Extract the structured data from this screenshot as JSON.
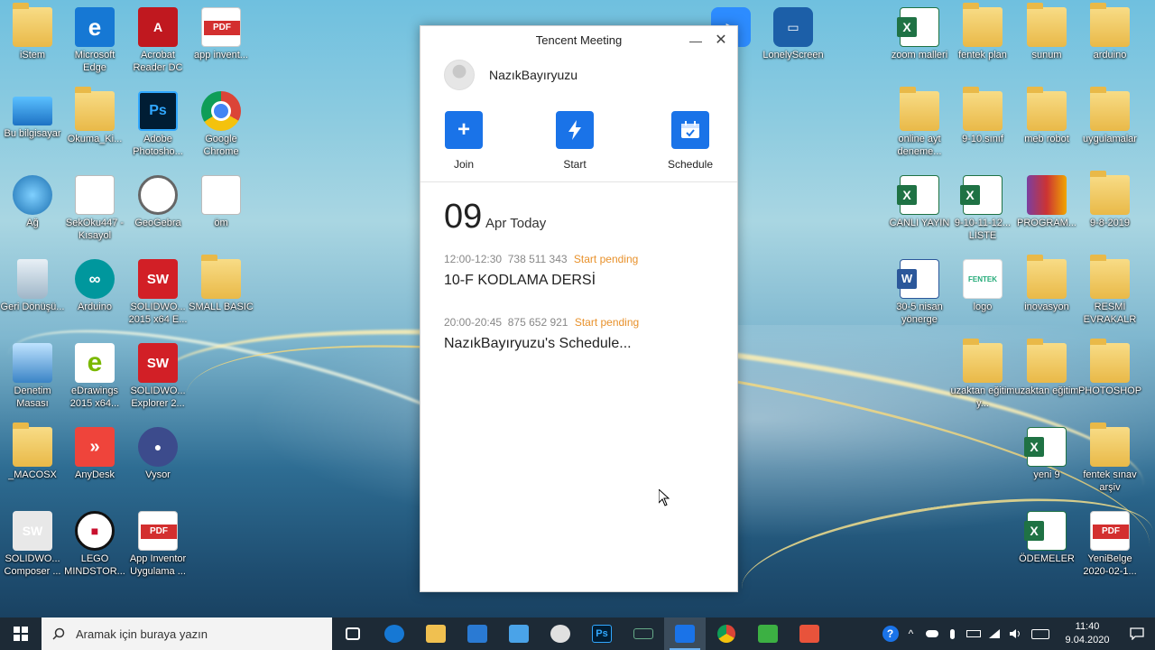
{
  "desktop_left": [
    {
      "label": "iStem",
      "kind": "folder"
    },
    {
      "label": "Microsoft Edge",
      "kind": "edge"
    },
    {
      "label": "Acrobat Reader DC",
      "kind": "acro"
    },
    {
      "label": "app invent...",
      "kind": "pdf"
    },
    {
      "label": "Bu bilgisayar",
      "kind": "pc"
    },
    {
      "label": "Okuma_Ki...",
      "kind": "folder"
    },
    {
      "label": "Adobe Photosho...",
      "kind": "ps"
    },
    {
      "label": "Google Chrome",
      "kind": "chrome"
    },
    {
      "label": "Ağ",
      "kind": "net"
    },
    {
      "label": "SekOku447 - Kısayol",
      "kind": "doc"
    },
    {
      "label": "GeoGebra",
      "kind": "geo"
    },
    {
      "label": "öm",
      "kind": "doc"
    },
    {
      "label": "Geri Dönüşü...",
      "kind": "bin"
    },
    {
      "label": "Arduino",
      "kind": "ard"
    },
    {
      "label": "SOLIDWO... 2015 x64 E...",
      "kind": "sw"
    },
    {
      "label": "SMALL BASIC",
      "kind": "folder"
    },
    {
      "label": "Denetim Masası",
      "kind": "ctrl"
    },
    {
      "label": "eDrawings 2015 x64...",
      "kind": "ed"
    },
    {
      "label": "SOLIDWO... Explorer 2...",
      "kind": "sw"
    },
    {
      "label": "_MACOSX",
      "kind": "folder"
    },
    {
      "label": "AnyDesk",
      "kind": "any"
    },
    {
      "label": "Vysor",
      "kind": "vys"
    },
    {
      "label": "SOLIDWO... Composer ...",
      "kind": "swc"
    },
    {
      "label": "LEGO MINDSTOR...",
      "kind": "lego"
    },
    {
      "label": "App Inventor Uygulama ...",
      "kind": "pdf"
    }
  ],
  "desktop_top": [
    {
      "label": "n",
      "kind": "zoom"
    },
    {
      "label": "LonelyScreen",
      "kind": "ls"
    }
  ],
  "desktop_right": [
    {
      "label": "zoom malleri",
      "kind": "xls"
    },
    {
      "label": "fentek plan",
      "kind": "folder"
    },
    {
      "label": "sunum",
      "kind": "folder"
    },
    {
      "label": "arduino",
      "kind": "folder"
    },
    {
      "label": "online ayt deneme...",
      "kind": "folder"
    },
    {
      "label": "9-10.sınıf",
      "kind": "folder"
    },
    {
      "label": "meb robot",
      "kind": "folder"
    },
    {
      "label": "uygulamalar",
      "kind": "folder"
    },
    {
      "label": "CANLI YAYIN",
      "kind": "xls"
    },
    {
      "label": "9-10-11-12... LİSTE",
      "kind": "xls"
    },
    {
      "label": "PROGRAM...",
      "kind": "rar"
    },
    {
      "label": "9-8-2019",
      "kind": "folder"
    },
    {
      "label": "30-5 nisan yönerge",
      "kind": "word"
    },
    {
      "label": "logo",
      "kind": "fentek"
    },
    {
      "label": "inovasyon",
      "kind": "folder"
    },
    {
      "label": "RESMİ EVRAKALR",
      "kind": "folder"
    },
    {
      "label": "uzaktan eğitim y...",
      "kind": "folder"
    },
    {
      "label": "uzaktan eğitim",
      "kind": "folder"
    },
    {
      "label": "PHOTOSHOP",
      "kind": "folder"
    },
    {
      "label": "yeni 9",
      "kind": "xls"
    },
    {
      "label": "fentek sınav arşiv",
      "kind": "folder"
    },
    {
      "label": "ÖDEMELER",
      "kind": "xls"
    },
    {
      "label": "YeniBelge 2020-02-1...",
      "kind": "pdf"
    }
  ],
  "window": {
    "title": "Tencent Meeting",
    "minimize": "—",
    "close": "✕",
    "username": "NazıkBayıryuzu",
    "actions": {
      "join": "Join",
      "start": "Start",
      "schedule": "Schedule"
    },
    "date": {
      "day": "09",
      "sub": "Apr Today"
    },
    "meetings": [
      {
        "time": "12:00-12:30",
        "id": "738 511 343",
        "status": "Start pending",
        "title": "10-F KODLAMA DERSİ"
      },
      {
        "time": "20:00-20:45",
        "id": "875 652 921",
        "status": "Start pending",
        "title": "NazıkBayıryuzu's Schedule..."
      }
    ]
  },
  "taskbar": {
    "search_placeholder": "Aramak için buraya yazın",
    "time": "11:40",
    "date": "9.04.2020"
  },
  "colors": {
    "accent": "#1a73e8",
    "pending": "#e8912b",
    "taskbar": "#1d2a36"
  }
}
